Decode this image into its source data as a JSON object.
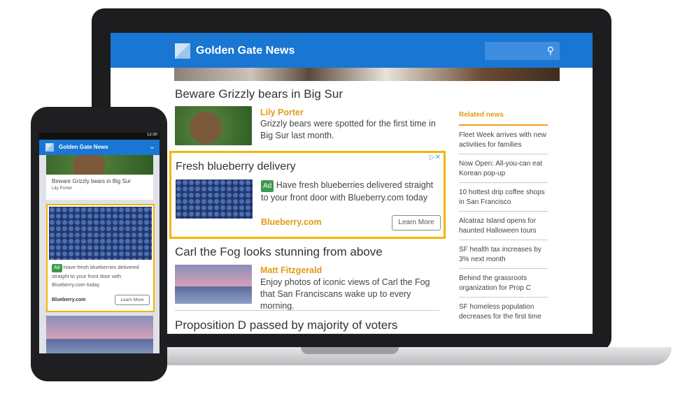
{
  "brand": "Golden Gate News",
  "colors": {
    "header": "#1976d2",
    "accent": "#f4b400",
    "author": "#e39b13",
    "ad_tag": "#3b9a4b"
  },
  "icons": {
    "search": "search-icon",
    "logo": "logo-icon",
    "adchoices": "adchoices-icon",
    "close": "close-icon",
    "chevron": "chevron-down-icon"
  },
  "laptop": {
    "articles": [
      {
        "title": "Beware Grizzly bears in Big Sur",
        "author": "Lily Porter",
        "summary": "Grizzly bears were spotted for the first time in Big Sur last month."
      },
      {
        "title": "Carl the Fog looks stunning from above",
        "author": "Matt Fitzgerald",
        "summary": "Enjoy photos of iconic views of Carl the Fog that San Franciscans wake up to every morning."
      },
      {
        "title": "Proposition D passed by majority of voters"
      }
    ],
    "ad": {
      "title": "Fresh blueberry delivery",
      "tag": "Ad",
      "text": "Have fresh blueberries delivered straight to your front door with Blueberry.com today",
      "advertiser": "Blueberry.com",
      "cta": "Learn More"
    },
    "related": {
      "heading": "Related news",
      "items": [
        "Fleet Week arrives with new activities for families",
        "Now Open: All-you-can eat Korean pop-up",
        "10 hottest drip coffee shops in San Francisco",
        "Alcatraz Island opens for haunted Halloween tours",
        "SF health tax increases by 3% next month",
        "Behind the grassroots organization for Prop C",
        "SF homeless population decreases for the first time"
      ]
    }
  },
  "phone": {
    "time": "12:30",
    "article": {
      "title": "Beware Grizzly bears in Big Sur",
      "author": "Lily Porter"
    },
    "ad": {
      "tag": "Ad",
      "text": "Have fresh blueberries delivered straight to your front door with Blueberry.com today",
      "advertiser": "Blueberry.com",
      "cta": "Learn More"
    }
  }
}
